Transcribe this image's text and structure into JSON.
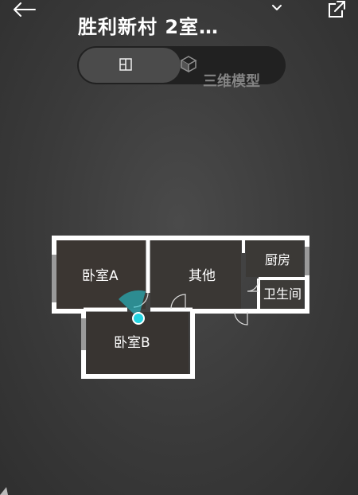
{
  "header": {
    "title": "胜利新村 2室…",
    "back_icon": "arrow-left-icon",
    "dropdown_icon": "chevron-down-icon",
    "share_icon": "external-link-icon"
  },
  "view_toggle": {
    "active_option_icon": "floorplan-2d-icon",
    "inactive_option_icon": "cube-3d-icon",
    "inactive_option_label": "三维模型"
  },
  "floorplan": {
    "rooms": [
      {
        "name": "卧室A"
      },
      {
        "name": "其他"
      },
      {
        "name": "厨房"
      },
      {
        "name": "卫生间"
      },
      {
        "name": "卧室B"
      }
    ],
    "current_location_color": "#22d3e0"
  },
  "colors": {
    "background": "#3a3a3a",
    "wall": "#ffffff",
    "accent": "#22d3e0"
  }
}
